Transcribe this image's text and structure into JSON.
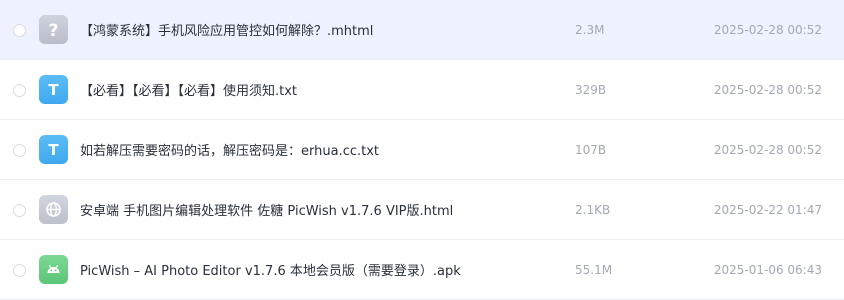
{
  "files": [
    {
      "name": "【鸿蒙系统】手机风险应用管控如何解除？.mhtml",
      "size": "2.3M",
      "date": "2025-02-28 00:52",
      "icon": "unknown-file-icon",
      "icon_color": "#c4c8d2",
      "selected": true
    },
    {
      "name": "【必看】【必看】【必看】使用须知.txt",
      "size": "329B",
      "date": "2025-02-28 00:52",
      "icon": "text-file-icon",
      "icon_color": "#4ab1f1"
    },
    {
      "name": "如若解压需要密码的话，解压密码是：erhua.cc.txt",
      "size": "107B",
      "date": "2025-02-28 00:52",
      "icon": "text-file-icon",
      "icon_color": "#4ab1f1"
    },
    {
      "name": "安卓端 手机图片编辑处理软件 佐糖 PicWish v1.7.6 VIP版.html",
      "size": "2.1KB",
      "date": "2025-02-22 01:47",
      "icon": "web-file-icon",
      "icon_color": "#c4c8d2"
    },
    {
      "name": "PicWish – AI Photo Editor v1.7.6 本地会员版（需要登录）.apk",
      "size": "55.1M",
      "date": "2025-01-06 06:43",
      "icon": "android-file-icon",
      "icon_color": "#6bcf85"
    }
  ]
}
